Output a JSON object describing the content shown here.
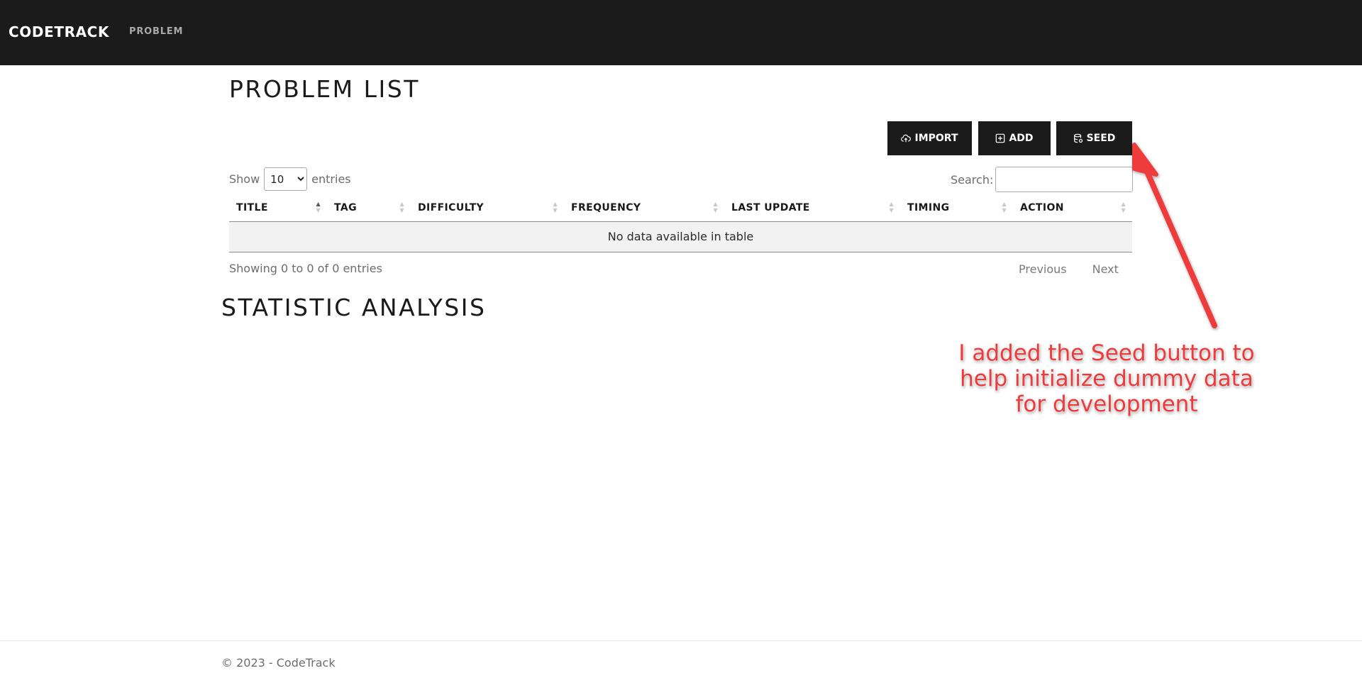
{
  "navbar": {
    "brand": "CODETRACK",
    "links": [
      "PROBLEM"
    ]
  },
  "problem_list": {
    "title": "PROBLEM LIST",
    "buttons": {
      "import": "IMPORT",
      "add": "ADD",
      "seed": "SEED"
    },
    "length": {
      "prefix": "Show",
      "value": "10",
      "suffix": "entries"
    },
    "search": {
      "label": "Search:",
      "value": ""
    },
    "columns": [
      "TITLE",
      "TAG",
      "DIFFICULTY",
      "FREQUENCY",
      "LAST UPDATE",
      "TIMING",
      "ACTION"
    ],
    "sorted_column": "TITLE",
    "empty_message": "No data available in table",
    "info": "Showing 0 to 0 of 0 entries",
    "pagination": {
      "previous": "Previous",
      "next": "Next"
    }
  },
  "statistic": {
    "title": "STATISTIC ANALYSIS"
  },
  "annotation": {
    "lines": [
      "I added the Seed button to",
      "help initialize dummy data",
      "for development"
    ],
    "color": "#ee3a3a"
  },
  "footer": {
    "text": "© 2023 - CodeTrack"
  },
  "colors": {
    "navbar": "#1b1b1b",
    "button": "#1b1b1b",
    "annotation": "#ee3a3a"
  }
}
